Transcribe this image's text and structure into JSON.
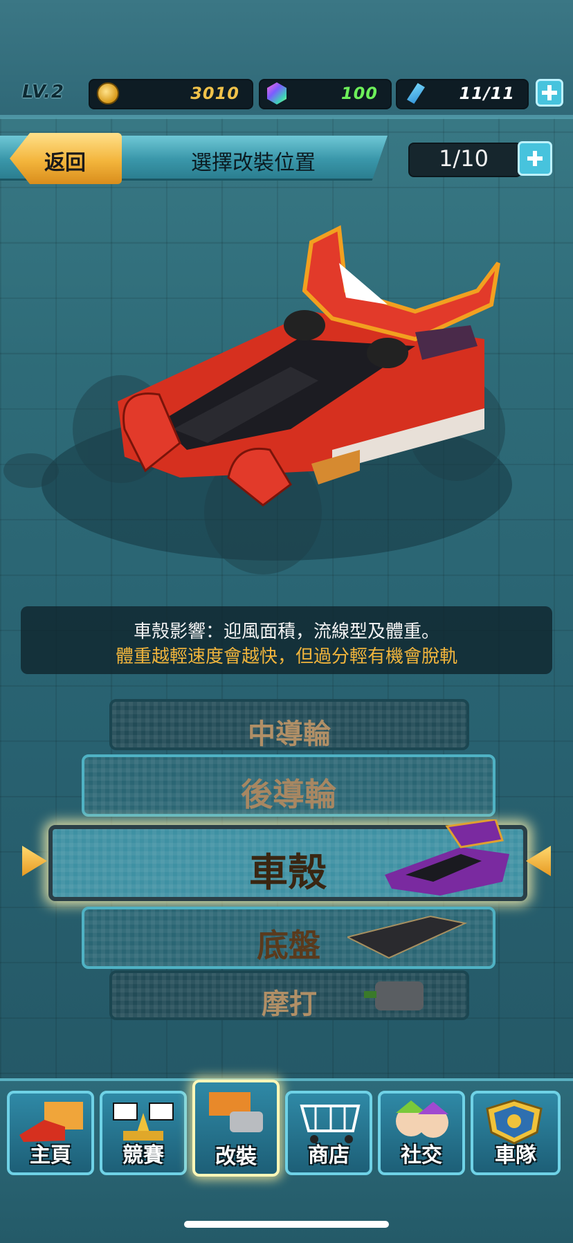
{
  "hud": {
    "level": "LV.2",
    "coins": "3010",
    "gems": "100",
    "energy": "11/11"
  },
  "header": {
    "back_label": "返回",
    "title": "選擇改裝位置",
    "counter": "1/10"
  },
  "info": {
    "line1": "車殼影響：迎風面積，流線型及體重。",
    "line2": "體重越輕速度會越快，但過分輕有機會脫軌"
  },
  "parts": {
    "items": [
      {
        "label": "中導輪",
        "selected": false
      },
      {
        "label": "後導輪",
        "selected": false
      },
      {
        "label": "車殼",
        "selected": true
      },
      {
        "label": "底盤",
        "selected": false
      },
      {
        "label": "摩打",
        "selected": false
      }
    ]
  },
  "nav": {
    "items": [
      {
        "label": "主頁",
        "icon": "home-car-icon"
      },
      {
        "label": "競賽",
        "icon": "race-flags-icon"
      },
      {
        "label": "改裝",
        "icon": "modify-box-icon",
        "active": true
      },
      {
        "label": "商店",
        "icon": "shop-cart-icon"
      },
      {
        "label": "社交",
        "icon": "social-people-icon"
      },
      {
        "label": "車隊",
        "icon": "team-shield-icon"
      }
    ]
  },
  "colors": {
    "accent_gold": "#f3b53c",
    "info_highlight": "#f0b43c",
    "teal_frame": "#6fd2e6",
    "car_red": "#e33a2a"
  }
}
